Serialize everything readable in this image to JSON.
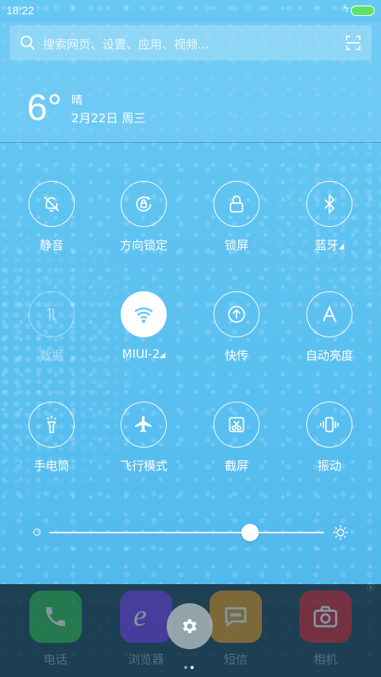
{
  "status_bar": {
    "time": "18:22",
    "charging_icon": "bolt-icon",
    "battery_color": "#5de36a"
  },
  "search": {
    "placeholder": "搜索网页、设置、应用、视频..."
  },
  "weather": {
    "temperature": "6°",
    "condition": "晴",
    "date": "2月22日 周三"
  },
  "toggles": [
    {
      "label": "静音",
      "icon": "bell-off-icon"
    },
    {
      "label": "方向锁定",
      "icon": "rotation-lock-icon"
    },
    {
      "label": "锁屏",
      "icon": "lock-icon"
    },
    {
      "label": "蓝牙",
      "icon": "bluetooth-icon"
    },
    {
      "label": "数据",
      "icon": "mobile-data-icon",
      "state": "disabled"
    },
    {
      "label": "MIUI-2",
      "icon": "wifi-icon",
      "state": "active"
    },
    {
      "label": "快传",
      "icon": "quick-transfer-icon"
    },
    {
      "label": "自动亮度",
      "icon": "auto-brightness-icon"
    },
    {
      "label": "手电筒",
      "icon": "flashlight-icon"
    },
    {
      "label": "飞行模式",
      "icon": "airplane-icon"
    },
    {
      "label": "截屏",
      "icon": "screenshot-icon"
    },
    {
      "label": "振动",
      "icon": "vibrate-icon"
    }
  ],
  "brightness": {
    "level": 0.73
  },
  "dock": {
    "apps": [
      {
        "name": "电话",
        "icon": "phone-icon",
        "color": "#2fbf4a"
      },
      {
        "name": "浏览器",
        "icon": "browser-icon",
        "color": "#7a3cf0"
      },
      {
        "name": "短信",
        "icon": "messages-icon",
        "color": "#f09a1a"
      },
      {
        "name": "相机",
        "icon": "camera-icon",
        "color": "#e0222e"
      }
    ]
  },
  "accent": "#5cc3f0"
}
